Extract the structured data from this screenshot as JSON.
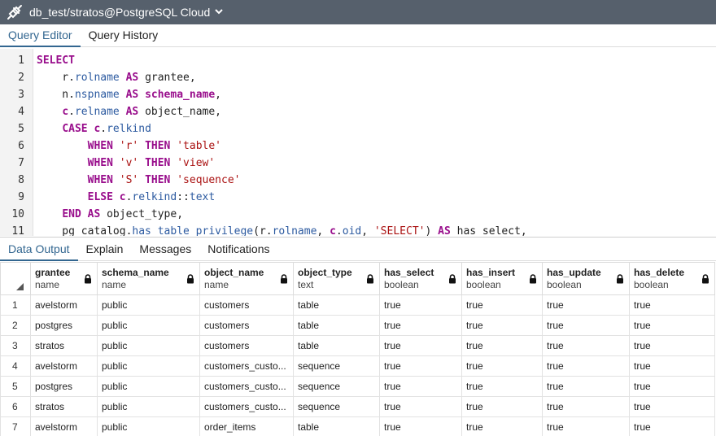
{
  "titlebar": {
    "connection": "db_test/stratos@PostgreSQL Cloud"
  },
  "top_tabs": [
    {
      "label": "Query Editor",
      "active": true
    },
    {
      "label": "Query History",
      "active": false
    }
  ],
  "editor": {
    "lines": [
      {
        "n": "1",
        "tokens": [
          {
            "t": "SELECT",
            "c": "kw"
          }
        ]
      },
      {
        "n": "2",
        "tokens": [
          {
            "t": "    r.",
            "c": "plain"
          },
          {
            "t": "rolname",
            "c": "var"
          },
          {
            "t": " ",
            "c": "plain"
          },
          {
            "t": "AS",
            "c": "kw"
          },
          {
            "t": " grantee,",
            "c": "plain"
          }
        ]
      },
      {
        "n": "3",
        "tokens": [
          {
            "t": "    n.",
            "c": "plain"
          },
          {
            "t": "nspname",
            "c": "var"
          },
          {
            "t": " ",
            "c": "plain"
          },
          {
            "t": "AS",
            "c": "kw"
          },
          {
            "t": " ",
            "c": "plain"
          },
          {
            "t": "schema_name",
            "c": "kw"
          },
          {
            "t": ",",
            "c": "plain"
          }
        ]
      },
      {
        "n": "4",
        "tokens": [
          {
            "t": "    ",
            "c": "plain"
          },
          {
            "t": "c",
            "c": "kw"
          },
          {
            "t": ".",
            "c": "plain"
          },
          {
            "t": "relname",
            "c": "var"
          },
          {
            "t": " ",
            "c": "plain"
          },
          {
            "t": "AS",
            "c": "kw"
          },
          {
            "t": " object_name,",
            "c": "plain"
          }
        ]
      },
      {
        "n": "5",
        "tokens": [
          {
            "t": "    ",
            "c": "plain"
          },
          {
            "t": "CASE",
            "c": "kw"
          },
          {
            "t": " ",
            "c": "plain"
          },
          {
            "t": "c",
            "c": "kw"
          },
          {
            "t": ".",
            "c": "plain"
          },
          {
            "t": "relkind",
            "c": "var"
          }
        ]
      },
      {
        "n": "6",
        "tokens": [
          {
            "t": "        ",
            "c": "plain"
          },
          {
            "t": "WHEN",
            "c": "kw"
          },
          {
            "t": " ",
            "c": "plain"
          },
          {
            "t": "'r'",
            "c": "str"
          },
          {
            "t": " ",
            "c": "plain"
          },
          {
            "t": "THEN",
            "c": "kw"
          },
          {
            "t": " ",
            "c": "plain"
          },
          {
            "t": "'table'",
            "c": "str"
          }
        ]
      },
      {
        "n": "7",
        "tokens": [
          {
            "t": "        ",
            "c": "plain"
          },
          {
            "t": "WHEN",
            "c": "kw"
          },
          {
            "t": " ",
            "c": "plain"
          },
          {
            "t": "'v'",
            "c": "str"
          },
          {
            "t": " ",
            "c": "plain"
          },
          {
            "t": "THEN",
            "c": "kw"
          },
          {
            "t": " ",
            "c": "plain"
          },
          {
            "t": "'view'",
            "c": "str"
          }
        ]
      },
      {
        "n": "8",
        "tokens": [
          {
            "t": "        ",
            "c": "plain"
          },
          {
            "t": "WHEN",
            "c": "kw"
          },
          {
            "t": " ",
            "c": "plain"
          },
          {
            "t": "'S'",
            "c": "str"
          },
          {
            "t": " ",
            "c": "plain"
          },
          {
            "t": "THEN",
            "c": "kw"
          },
          {
            "t": " ",
            "c": "plain"
          },
          {
            "t": "'sequence'",
            "c": "str"
          }
        ]
      },
      {
        "n": "9",
        "tokens": [
          {
            "t": "        ",
            "c": "plain"
          },
          {
            "t": "ELSE",
            "c": "kw"
          },
          {
            "t": " ",
            "c": "plain"
          },
          {
            "t": "c",
            "c": "kw"
          },
          {
            "t": ".",
            "c": "plain"
          },
          {
            "t": "relkind",
            "c": "var"
          },
          {
            "t": "::",
            "c": "plain"
          },
          {
            "t": "text",
            "c": "var"
          }
        ]
      },
      {
        "n": "10",
        "tokens": [
          {
            "t": "    ",
            "c": "plain"
          },
          {
            "t": "END",
            "c": "kw"
          },
          {
            "t": " ",
            "c": "plain"
          },
          {
            "t": "AS",
            "c": "kw"
          },
          {
            "t": " object_type,",
            "c": "plain"
          }
        ]
      },
      {
        "n": "11",
        "tokens": [
          {
            "t": "    pg_catalog.",
            "c": "plain"
          },
          {
            "t": "has_table_privilege",
            "c": "var"
          },
          {
            "t": "(r.",
            "c": "plain"
          },
          {
            "t": "rolname",
            "c": "var"
          },
          {
            "t": ", ",
            "c": "plain"
          },
          {
            "t": "c",
            "c": "kw"
          },
          {
            "t": ".",
            "c": "plain"
          },
          {
            "t": "oid",
            "c": "var"
          },
          {
            "t": ", ",
            "c": "plain"
          },
          {
            "t": "'SELECT'",
            "c": "str"
          },
          {
            "t": ") ",
            "c": "plain"
          },
          {
            "t": "AS",
            "c": "kw"
          },
          {
            "t": " has_select,",
            "c": "plain"
          }
        ]
      }
    ]
  },
  "bottom_tabs": [
    {
      "label": "Data Output",
      "active": true
    },
    {
      "label": "Explain",
      "active": false
    },
    {
      "label": "Messages",
      "active": false
    },
    {
      "label": "Notifications",
      "active": false
    }
  ],
  "grid": {
    "columns": [
      {
        "name": "grantee",
        "type": "name"
      },
      {
        "name": "schema_name",
        "type": "name"
      },
      {
        "name": "object_name",
        "type": "name"
      },
      {
        "name": "object_type",
        "type": "text"
      },
      {
        "name": "has_select",
        "type": "boolean"
      },
      {
        "name": "has_insert",
        "type": "boolean"
      },
      {
        "name": "has_update",
        "type": "boolean"
      },
      {
        "name": "has_delete",
        "type": "boolean"
      }
    ],
    "rows": [
      {
        "n": "1",
        "cells": [
          "avelstorm",
          "public",
          "customers",
          "table",
          "true",
          "true",
          "true",
          "true"
        ]
      },
      {
        "n": "2",
        "cells": [
          "postgres",
          "public",
          "customers",
          "table",
          "true",
          "true",
          "true",
          "true"
        ]
      },
      {
        "n": "3",
        "cells": [
          "stratos",
          "public",
          "customers",
          "table",
          "true",
          "true",
          "true",
          "true"
        ]
      },
      {
        "n": "4",
        "cells": [
          "avelstorm",
          "public",
          "customers_custo...",
          "sequence",
          "true",
          "true",
          "true",
          "true"
        ]
      },
      {
        "n": "5",
        "cells": [
          "postgres",
          "public",
          "customers_custo...",
          "sequence",
          "true",
          "true",
          "true",
          "true"
        ]
      },
      {
        "n": "6",
        "cells": [
          "stratos",
          "public",
          "customers_custo...",
          "sequence",
          "true",
          "true",
          "true",
          "true"
        ]
      },
      {
        "n": "7",
        "cells": [
          "avelstorm",
          "public",
          "order_items",
          "table",
          "true",
          "true",
          "true",
          "true"
        ]
      }
    ]
  },
  "colors": {
    "titlebar": "#56606c",
    "accent": "#326690",
    "keyword": "#990e8c",
    "identifier": "#2c5aa0",
    "string": "#aa1111"
  },
  "icons": {
    "connection": "plug-disconnected-icon",
    "dropdown": "chevron-down-icon",
    "column_lock": "lock-icon",
    "sort_corner": "sort-corner-icon"
  }
}
